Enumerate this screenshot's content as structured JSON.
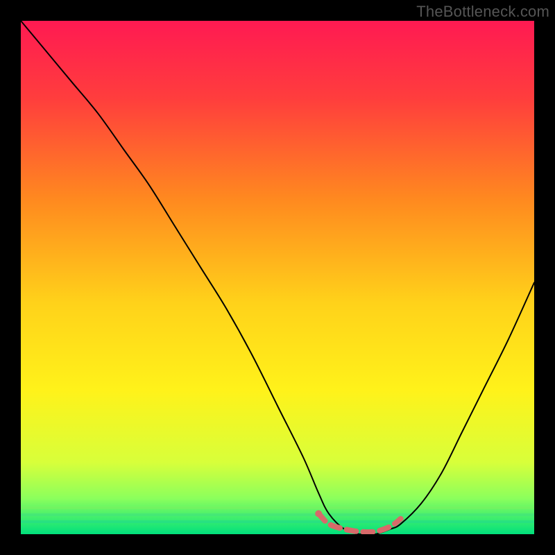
{
  "watermark": "TheBottleneck.com",
  "chart_data": {
    "type": "line",
    "title": "",
    "xlabel": "",
    "ylabel": "",
    "xlim": [
      0,
      100
    ],
    "ylim": [
      0,
      100
    ],
    "grid": false,
    "legend": false,
    "background_gradient": {
      "stops": [
        {
          "pct": 0,
          "color": "#ff1a52"
        },
        {
          "pct": 15,
          "color": "#ff3d3d"
        },
        {
          "pct": 35,
          "color": "#ff8a1f"
        },
        {
          "pct": 55,
          "color": "#ffd21a"
        },
        {
          "pct": 72,
          "color": "#fff21a"
        },
        {
          "pct": 86,
          "color": "#d8ff3a"
        },
        {
          "pct": 93,
          "color": "#8cff5c"
        },
        {
          "pct": 100,
          "color": "#00e07c"
        }
      ]
    },
    "series": [
      {
        "name": "bottleneck-curve",
        "stroke": "#000000",
        "x": [
          0,
          5,
          10,
          15,
          20,
          25,
          30,
          35,
          40,
          45,
          50,
          55,
          58,
          60,
          63,
          66,
          69,
          72,
          74,
          78,
          82,
          86,
          90,
          95,
          100
        ],
        "y": [
          100,
          94,
          88,
          82,
          75,
          68,
          60,
          52,
          44,
          35,
          25,
          15,
          8,
          4,
          1,
          0,
          0,
          1,
          2,
          6,
          12,
          20,
          28,
          38,
          49
        ]
      },
      {
        "name": "optimal-zone-marker",
        "stroke": "#d76a6a",
        "stroke_width": 8,
        "x": [
          58,
          60,
          63,
          66,
          69,
          72,
          74
        ],
        "y": [
          4,
          2,
          1,
          0.5,
          0.5,
          1.5,
          3
        ]
      }
    ],
    "annotations": []
  }
}
